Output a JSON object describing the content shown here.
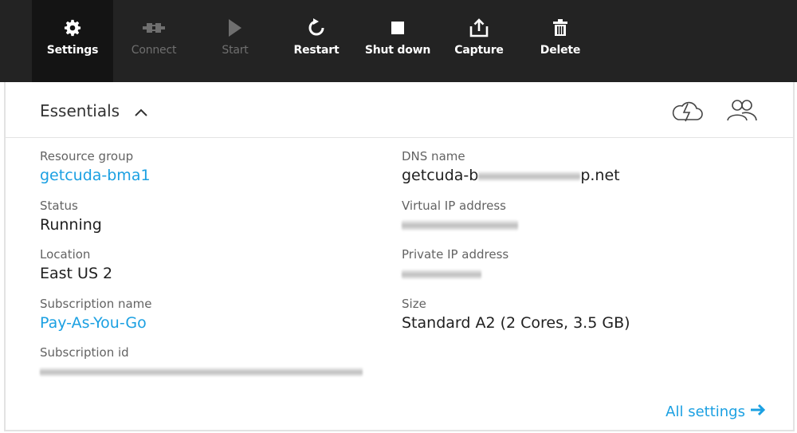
{
  "toolbar": {
    "buttons": [
      {
        "label": "Settings",
        "icon": "gear-icon",
        "state": "active"
      },
      {
        "label": "Connect",
        "icon": "plug-icon",
        "state": "disabled"
      },
      {
        "label": "Start",
        "icon": "play-icon",
        "state": "disabled"
      },
      {
        "label": "Restart",
        "icon": "restart-icon",
        "state": "enabled"
      },
      {
        "label": "Shut down",
        "icon": "stop-icon",
        "state": "enabled"
      },
      {
        "label": "Capture",
        "icon": "capture-icon",
        "state": "enabled"
      },
      {
        "label": "Delete",
        "icon": "trash-icon",
        "state": "enabled"
      }
    ],
    "colors": {
      "background": "#232323",
      "active_background": "#141414",
      "text": "#ffffff",
      "disabled_text": "#6f6f6f"
    }
  },
  "essentials": {
    "title": "Essentials",
    "toggle_icon": "chevron-up-icon",
    "header_icons": [
      "cloud-lightning-icon",
      "users-icon"
    ],
    "left": {
      "resource_group": {
        "label": "Resource group",
        "value": "getcuda-bma1"
      },
      "status": {
        "label": "Status",
        "value": "Running"
      },
      "location": {
        "label": "Location",
        "value": "East US 2"
      },
      "subscription_name": {
        "label": "Subscription name",
        "value": "Pay-As-You-Go"
      },
      "subscription_id": {
        "label": "Subscription id"
      }
    },
    "right": {
      "dns_name": {
        "label": "DNS name",
        "value_prefix": "getcuda-b",
        "value_suffix": "p.net"
      },
      "virtual_ip": {
        "label": "Virtual IP address"
      },
      "private_ip": {
        "label": "Private IP address"
      },
      "size": {
        "label": "Size",
        "value": "Standard A2 (2 Cores, 3.5 GB)"
      }
    },
    "all_settings": "All settings",
    "link_color": "#1ba0e2"
  }
}
